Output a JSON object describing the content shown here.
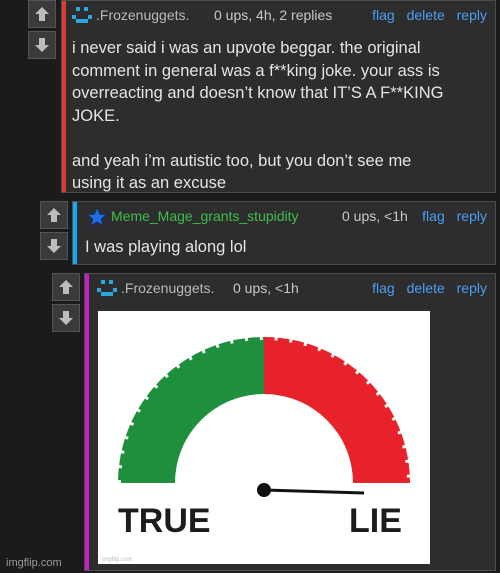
{
  "comments": [
    {
      "username": ".Frozenuggets.",
      "meta": "0 ups, 4h, 2 replies",
      "actions": [
        "flag",
        "delete",
        "reply"
      ],
      "text_lines": [
        "i never said i was an upvote beggar. the original",
        "comment in general was a f**king joke. your ass is",
        "overreacting and doesn’t know that IT’S A F**KING",
        "JOKE.",
        "",
        "and yeah i’m autistic too, but you don’t see me",
        "using it as an excuse"
      ],
      "accent": "#e0393a",
      "avatar_icon": "pixel-face-icon"
    },
    {
      "username": "Meme_Mage_grants_stupidity",
      "meta": "0 ups, <1h",
      "actions": [
        "flag",
        "reply"
      ],
      "text": "I was playing along lol",
      "accent": "#1aa9ee",
      "avatar_icon": "star-icon"
    },
    {
      "username": ".Frozenuggets.",
      "meta": "0 ups, <1h",
      "actions": [
        "flag",
        "delete",
        "reply"
      ],
      "accent": "#c81fc4",
      "avatar_icon": "pixel-face-icon",
      "image": {
        "left_label": "TRUE",
        "right_label": "LIE",
        "credit": "imgflip.com",
        "colors": {
          "true": "#1e8f3c",
          "lie": "#e8222a"
        }
      }
    }
  ],
  "watermark": "imgflip.com",
  "colors": {
    "link": "#4a9ef2",
    "username_green": "#3fbf4a",
    "avatar_cyan": "#2aa6e0"
  }
}
